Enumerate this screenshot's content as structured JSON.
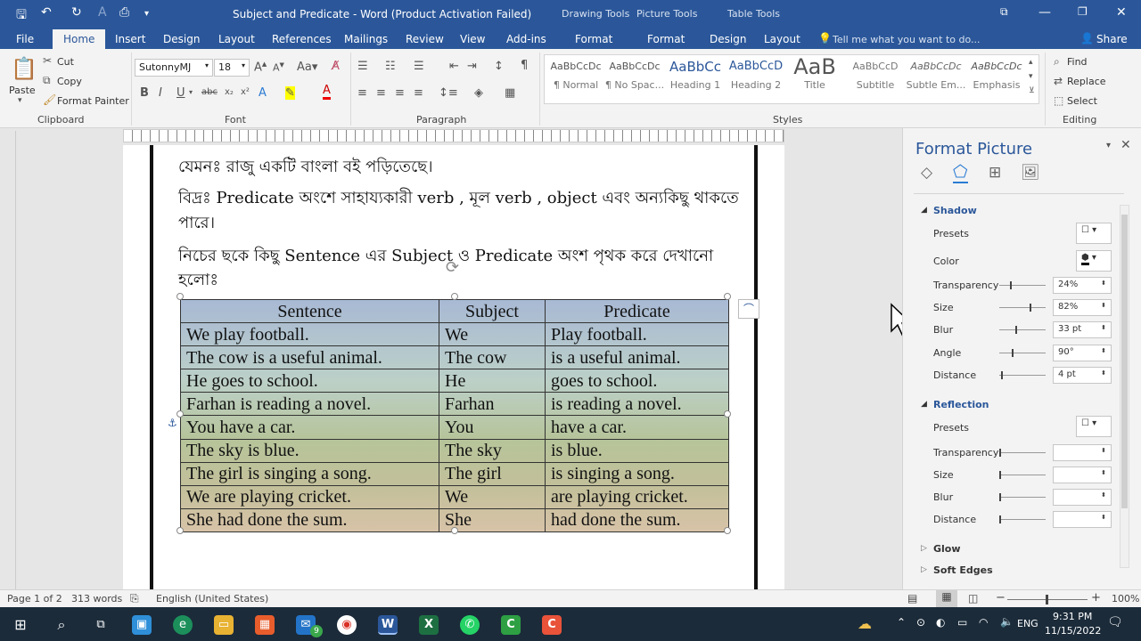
{
  "app": {
    "title": "Subject and Predicate - Word (Product Activation Failed)"
  },
  "colors": {
    "accent": "#2b579a",
    "taskbar": "#1b2b3a",
    "misspell": "#e02020"
  },
  "context_groups": [
    "Drawing Tools",
    "Picture Tools",
    "Table Tools"
  ],
  "tabs": [
    "File",
    "Home",
    "Insert",
    "Design",
    "Layout",
    "References",
    "Mailings",
    "Review",
    "View",
    "Add-ins",
    "Format",
    "Format",
    "Design",
    "Layout"
  ],
  "tell_me": "Tell me what you want to do...",
  "share": "Share",
  "ribbon": {
    "clipboard": {
      "paste": "Paste",
      "cut": "Cut",
      "copy": "Copy",
      "format_painter": "Format Painter",
      "label": "Clipboard"
    },
    "font": {
      "name": "SutonnyMJ",
      "size": "18",
      "label": "Font"
    },
    "paragraph": {
      "label": "Paragraph"
    },
    "styles": {
      "label": "Styles",
      "items": [
        {
          "preview": "AaBbCcDc",
          "name": "¶ Normal"
        },
        {
          "preview": "AaBbCcDc",
          "name": "¶ No Spac..."
        },
        {
          "preview": "AaBbCc",
          "name": "Heading 1"
        },
        {
          "preview": "AaBbCcD",
          "name": "Heading 2"
        },
        {
          "preview": "AaB",
          "name": "Title"
        },
        {
          "preview": "AaBbCcD",
          "name": "Subtitle"
        },
        {
          "preview": "AaBbCcDc",
          "name": "Subtle Em..."
        },
        {
          "preview": "AaBbCcDc",
          "name": "Emphasis"
        }
      ]
    },
    "editing": {
      "find": "Find",
      "replace": "Replace",
      "select": "Select",
      "label": "Editing"
    }
  },
  "document": {
    "line1": "যেমনঃ রাজু একটি বাংলা বই পড়িতেছে।",
    "line2": "বিদ্রঃ Predicate অংশে সাহায্যকারী verb , মূল verb , object এবং অন্যকিছু থাকতে",
    "line3": "পারে।",
    "line4": "নিচের ছকে কিছু Sentence এর Subject ও Predicate অংশ পৃথক করে দেখানো",
    "line5": "হলোঃ",
    "table_headers": [
      "Sentence",
      "Subject",
      "Predicate"
    ],
    "table_rows": [
      [
        "We play football.",
        "We",
        "Play football."
      ],
      [
        "The cow is a useful animal.",
        "The cow",
        "is a useful animal."
      ],
      [
        "He goes to school.",
        "He",
        "goes to school."
      ],
      [
        "Farhan is reading a novel.",
        "Farhan",
        "is reading a novel."
      ],
      [
        "You have a car.",
        "You",
        "have a car."
      ],
      [
        "The sky is blue.",
        "The sky",
        "is blue."
      ],
      [
        "The girl is singing a song.",
        "The girl",
        "is singing a song."
      ],
      [
        "We are playing cricket.",
        "We",
        "are playing cricket."
      ],
      [
        "She had done the sum.",
        "She",
        "had done the sum."
      ]
    ]
  },
  "pane": {
    "title": "Format Picture",
    "shadow": {
      "label": "Shadow",
      "presets": "Presets",
      "color": "Color",
      "transparency": "Transparency",
      "transparency_val": "24%",
      "size": "Size",
      "size_val": "82%",
      "blur": "Blur",
      "blur_val": "33 pt",
      "angle": "Angle",
      "angle_val": "90°",
      "distance": "Distance",
      "distance_val": "4 pt"
    },
    "reflection": {
      "label": "Reflection",
      "presets": "Presets",
      "transparency": "Transparency",
      "size": "Size",
      "blur": "Blur",
      "distance": "Distance"
    },
    "glow": "Glow",
    "soft_edges": "Soft Edges"
  },
  "status": {
    "page": "Page 1 of 2",
    "words": "313 words",
    "language": "English (United States)",
    "zoom": "100%"
  },
  "taskbar": {
    "time": "9:31 PM",
    "date": "11/15/2022",
    "lang": "ENG",
    "mail_badge": "9"
  }
}
